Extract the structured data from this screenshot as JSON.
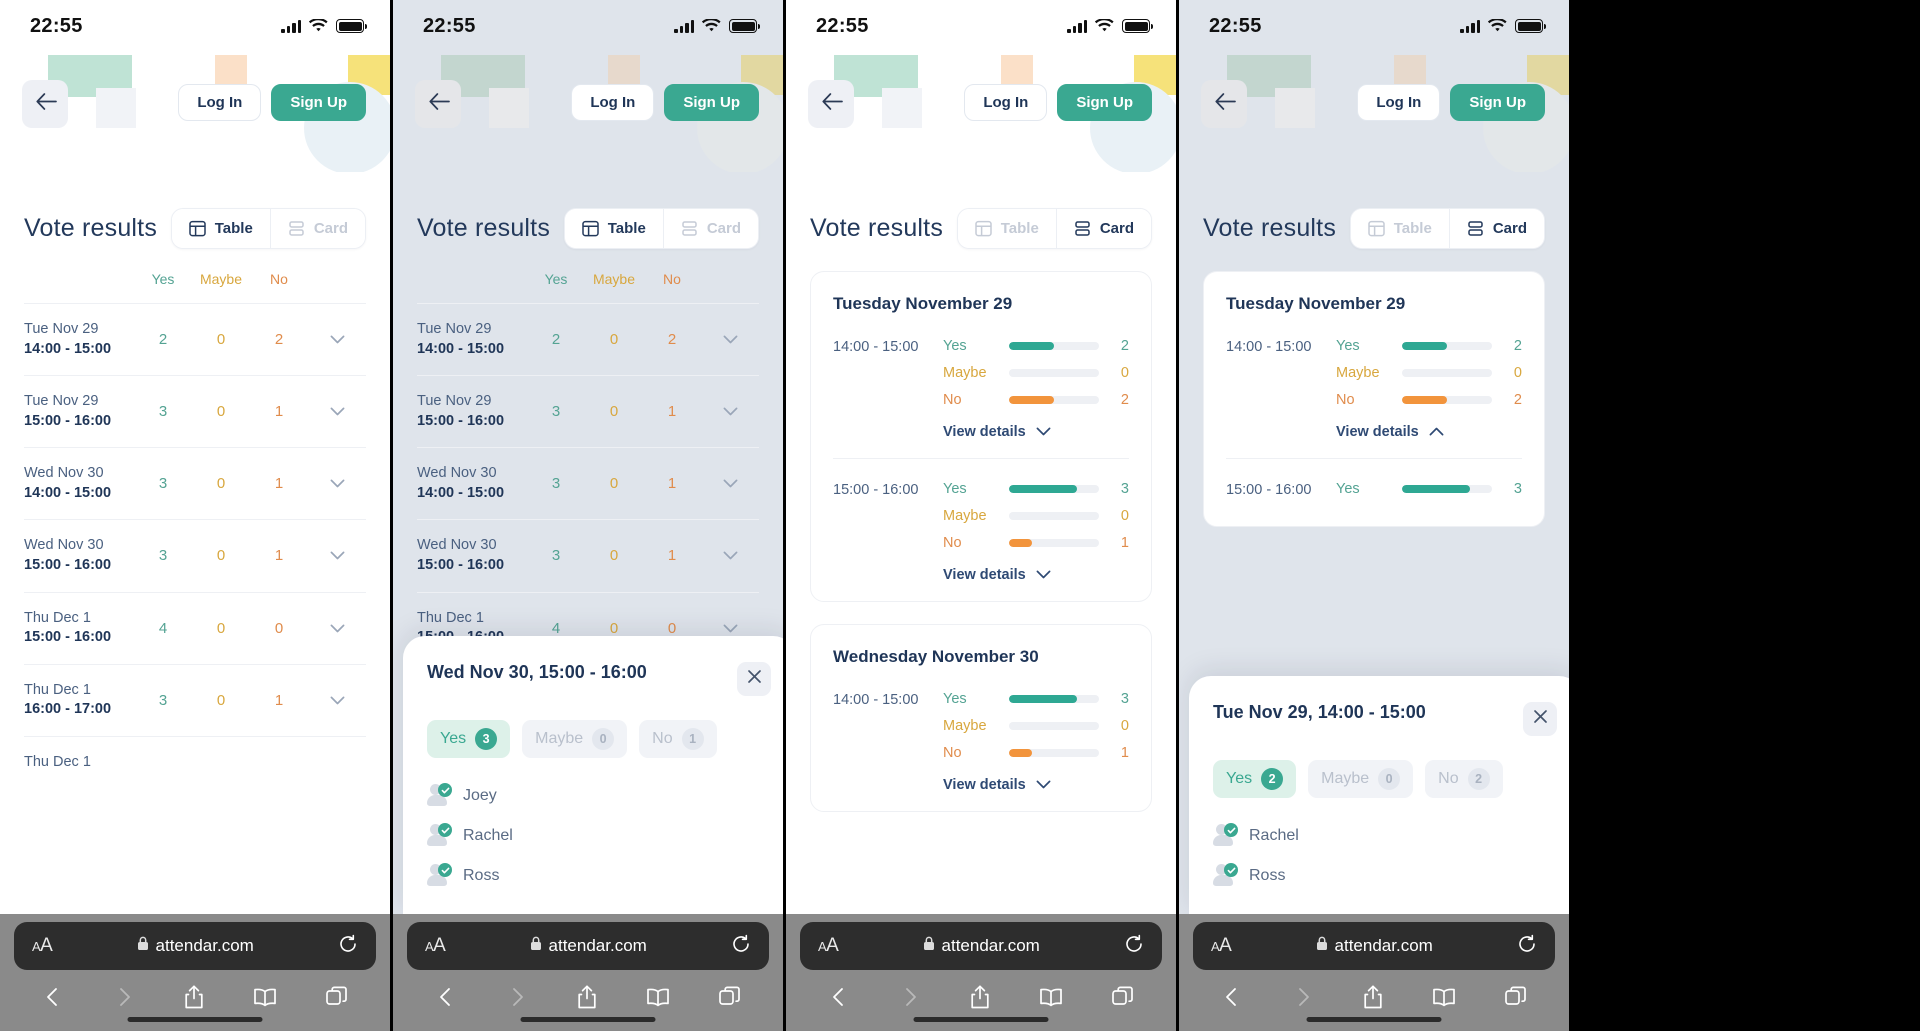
{
  "status_bar": {
    "time": "22:55"
  },
  "header": {
    "back_icon": "arrow-left-icon",
    "login_label": "Log In",
    "signup_label": "Sign Up"
  },
  "page_title": "Vote results",
  "view_toggle": {
    "table_label": "Table",
    "card_label": "Card"
  },
  "table": {
    "columns": [
      "",
      "Yes",
      "Maybe",
      "No",
      ""
    ],
    "rows": [
      {
        "date": "Tue Nov 29",
        "time": "14:00 - 15:00",
        "yes": "2",
        "maybe": "0",
        "no": "2"
      },
      {
        "date": "Tue Nov 29",
        "time": "15:00 - 16:00",
        "yes": "3",
        "maybe": "0",
        "no": "1"
      },
      {
        "date": "Wed Nov 30",
        "time": "14:00 - 15:00",
        "yes": "3",
        "maybe": "0",
        "no": "1"
      },
      {
        "date": "Wed Nov 30",
        "time": "15:00 - 16:00",
        "yes": "3",
        "maybe": "0",
        "no": "1"
      },
      {
        "date": "Thu Dec 1",
        "time": "15:00 - 16:00",
        "yes": "4",
        "maybe": "0",
        "no": "0"
      },
      {
        "date": "Thu Dec 1",
        "time": "16:00 - 17:00",
        "yes": "3",
        "maybe": "0",
        "no": "1"
      },
      {
        "date": "Thu Dec 1",
        "time": "",
        "yes": "",
        "maybe": "",
        "no": ""
      }
    ]
  },
  "cards": [
    {
      "title": "Tuesday November 29",
      "slots": [
        {
          "time": "14:00 - 15:00",
          "details_label": "View details",
          "meters": [
            {
              "label": "Yes",
              "value": "2",
              "pct": 50
            },
            {
              "label": "Maybe",
              "value": "0",
              "pct": 0
            },
            {
              "label": "No",
              "value": "2",
              "pct": 50
            }
          ]
        },
        {
          "time": "15:00 - 16:00",
          "details_label": "View details",
          "meters": [
            {
              "label": "Yes",
              "value": "3",
              "pct": 75
            },
            {
              "label": "Maybe",
              "value": "0",
              "pct": 0
            },
            {
              "label": "No",
              "value": "1",
              "pct": 25
            }
          ]
        }
      ]
    },
    {
      "title": "Wednesday November 30",
      "slots": [
        {
          "time": "14:00 - 15:00",
          "details_label": "View details",
          "meters": [
            {
              "label": "Yes",
              "value": "3",
              "pct": 75
            },
            {
              "label": "Maybe",
              "value": "0",
              "pct": 0
            },
            {
              "label": "No",
              "value": "1",
              "pct": 25
            }
          ]
        }
      ]
    }
  ],
  "sheet_panel2": {
    "title": "Wed Nov 30, 15:00 - 16:00",
    "close_icon": "close-icon",
    "chips": [
      {
        "label": "Yes",
        "count": "3",
        "state": "active"
      },
      {
        "label": "Maybe",
        "count": "0",
        "state": "muted"
      },
      {
        "label": "No",
        "count": "1",
        "state": "muted"
      }
    ],
    "people": [
      "Joey",
      "Rachel",
      "Ross"
    ]
  },
  "sheet_panel4": {
    "title": "Tue Nov 29, 14:00 - 15:00",
    "close_icon": "close-icon",
    "chips": [
      {
        "label": "Yes",
        "count": "2",
        "state": "active"
      },
      {
        "label": "Maybe",
        "count": "0",
        "state": "muted"
      },
      {
        "label": "No",
        "count": "2",
        "state": "muted"
      }
    ],
    "people": [
      "Rachel",
      "Ross"
    ]
  },
  "panel4_card": {
    "title": "Tuesday November 29",
    "slot1_time": "14:00 - 15:00",
    "slot1_details_label": "View details",
    "slot2_time": "15:00 - 16:00",
    "slot2_yes_label": "Yes",
    "slot2_yes_value": "3"
  },
  "browser": {
    "aa_small": "A",
    "aa_large": "A",
    "lock_icon": "lock-icon",
    "url": "attendar.com",
    "reload_icon": "reload-icon",
    "back_icon": "chevron-left-icon",
    "forward_icon": "chevron-right-icon",
    "share_icon": "share-icon",
    "bookmarks_icon": "book-icon",
    "tabs_icon": "tabs-icon"
  },
  "colors": {
    "accent_teal": "#3aa891",
    "yes": "#54a393",
    "maybe": "#d8a73e",
    "no": "#e08c4c",
    "navy": "#1f3557",
    "bar_yes": "#2ea893",
    "bar_no": "#f2943c",
    "track": "#eef0f4"
  }
}
